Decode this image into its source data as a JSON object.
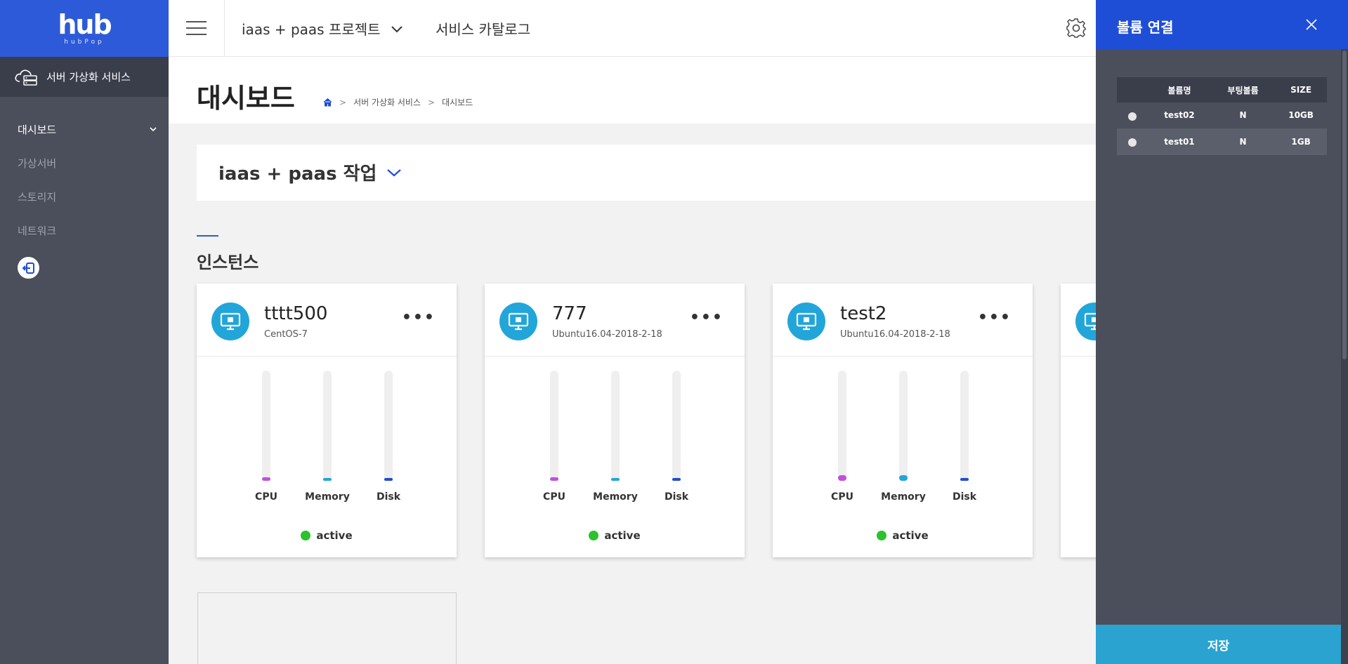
{
  "brand": {
    "logo": "hub",
    "sub": "hubPop"
  },
  "sidebar": {
    "service_title": "서버 가상화 서비스",
    "items": [
      {
        "label": "대시보드",
        "active": true
      },
      {
        "label": "가상서버"
      },
      {
        "label": "스토리지"
      },
      {
        "label": "네트워크"
      }
    ]
  },
  "topbar": {
    "project": "iaas + paas 프로젝트",
    "catalog": "서비스 카탈로그"
  },
  "page": {
    "title": "대시보드",
    "breadcrumb": [
      "서버 가상화 서비스",
      "대시보드"
    ]
  },
  "project_card": {
    "title": "iaas + paas 작업"
  },
  "instances_section": {
    "title": "인스턴스"
  },
  "gauge_labels": {
    "cpu": "CPU",
    "memory": "Memory",
    "disk": "Disk"
  },
  "instances": [
    {
      "name": "tttt500",
      "os": "CentOS-7",
      "status": "active",
      "cpu": 3,
      "memory": 1,
      "disk": 0
    },
    {
      "name": "777",
      "os": "Ubuntu16.04-2018-2-18",
      "status": "active",
      "cpu": 3,
      "memory": 1,
      "disk": 0
    },
    {
      "name": "test2",
      "os": "Ubuntu16.04-2018-2-18",
      "status": "active",
      "cpu": 5,
      "memory": 5,
      "disk": 2
    }
  ],
  "colors": {
    "cpu": "#c24ee0",
    "memory": "#22a6d9",
    "disk": "#1f4ed6",
    "status": "#2dc12d"
  },
  "panel": {
    "title": "볼륨 연결",
    "columns": [
      "볼륨명",
      "부팅볼륨",
      "SIZE"
    ],
    "rows": [
      {
        "name": "test02",
        "boot": "N",
        "size": "10GB"
      },
      {
        "name": "test01",
        "boot": "N",
        "size": "1GB"
      }
    ],
    "save_label": "저장"
  }
}
